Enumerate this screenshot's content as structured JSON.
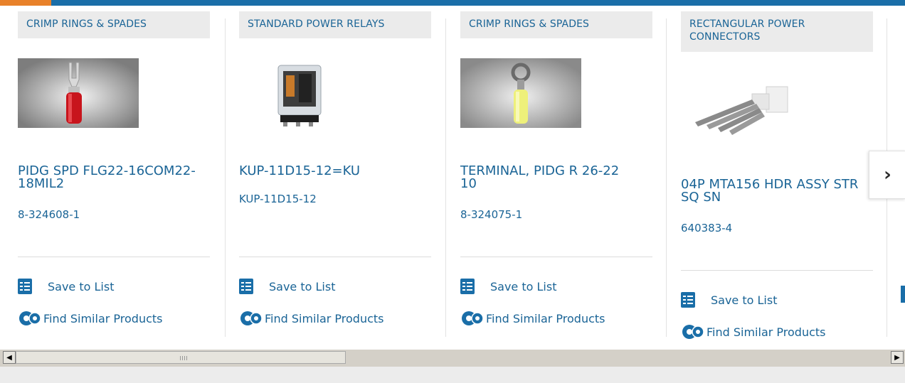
{
  "cards": [
    {
      "category": "CRIMP RINGS & SPADES",
      "title": "PIDG SPD FLG22-16COM22-18MIL2",
      "part_number": "8-324608-1",
      "image": "red-spade-terminal",
      "save": "Save to List",
      "similar": "Find Similar Products"
    },
    {
      "category": "STANDARD POWER RELAYS",
      "title": "KUP-11D15-12=KU",
      "part_number": "KUP-11D15-12",
      "image": "power-relay",
      "save": "Save to List",
      "similar": "Find Similar Products"
    },
    {
      "category": "CRIMP RINGS & SPADES",
      "title": "TERMINAL, PIDG R 26-22 10",
      "part_number": "8-324075-1",
      "image": "yellow-ring-terminal",
      "save": "Save to List",
      "similar": "Find Similar Products"
    },
    {
      "category": "RECTANGULAR POWER CONNECTORS",
      "title": "04P MTA156 HDR ASSY STR SQ SN",
      "part_number": "640383-4",
      "image": "white-header-connector",
      "save": "Save to List",
      "similar": "Find Similar Products"
    }
  ],
  "carousel": {
    "next_icon": "chevron-right-icon",
    "next_glyph": "›"
  },
  "scrollbar": {
    "left_glyph": "◀",
    "right_glyph": "▶",
    "thumb_position": 0.34
  },
  "colors": {
    "link": "#1a6496",
    "accent_bar": "#1a6ea8",
    "accent_orange": "#e8812a"
  }
}
